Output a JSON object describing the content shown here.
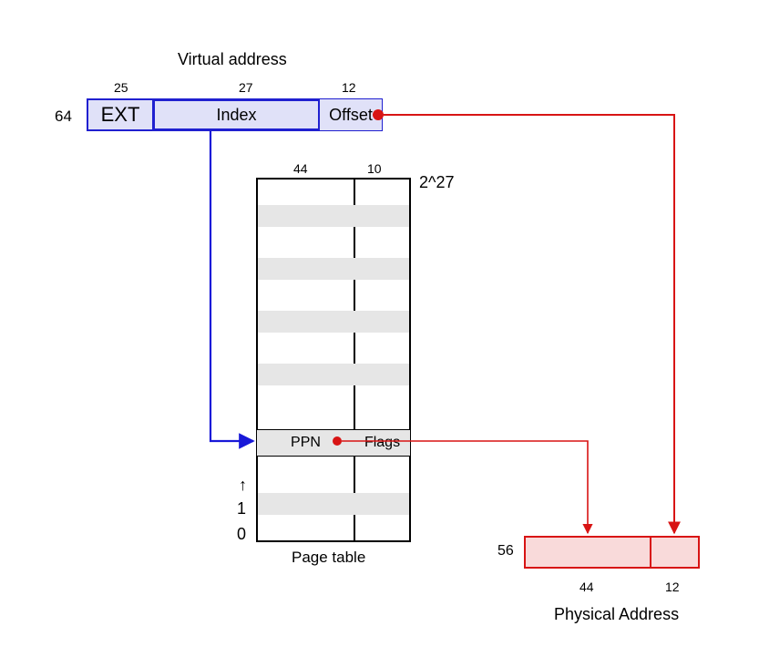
{
  "virtual_address": {
    "title": "Virtual address",
    "total_bits_label": "64",
    "fields": [
      {
        "name": "EXT",
        "bits": "25"
      },
      {
        "name": "Index",
        "bits": "27"
      },
      {
        "name": "Offset",
        "bits": "12"
      }
    ]
  },
  "page_table": {
    "title": "Page table",
    "entries_label": "2^27",
    "col_bits": {
      "ppn": "44",
      "flags": "10"
    },
    "row_labels": {
      "ppn": "PPN",
      "flags": "Flags"
    },
    "index_markers": [
      "0",
      "1"
    ],
    "up_arrow": "↑"
  },
  "physical_address": {
    "title": "Physical Address",
    "total_bits_label": "56",
    "fields": [
      {
        "bits": "44"
      },
      {
        "bits": "12"
      }
    ]
  }
}
